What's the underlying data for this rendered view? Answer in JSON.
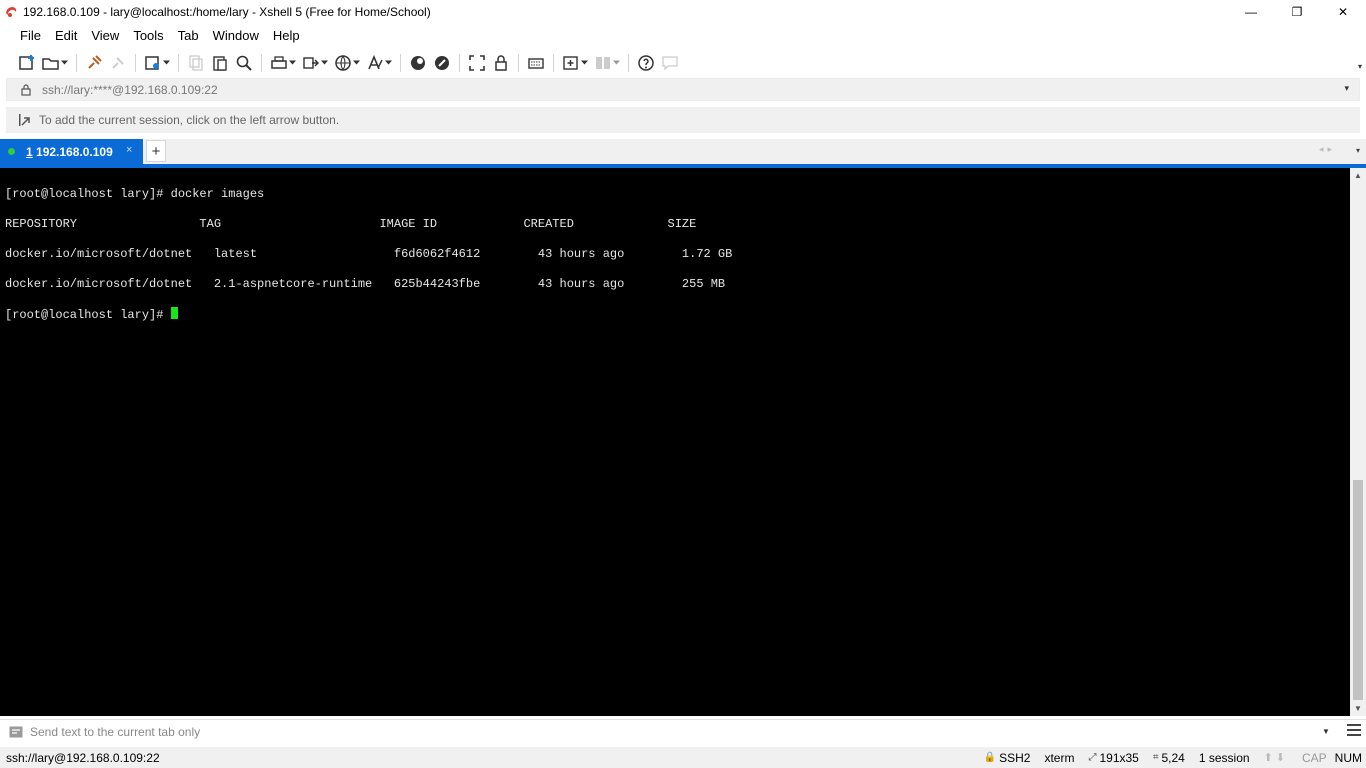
{
  "window": {
    "title": "192.168.0.109 - lary@localhost:/home/lary - Xshell 5 (Free for Home/School)",
    "minimize": "—",
    "maximize": "❐",
    "close": "✕"
  },
  "menu": [
    "File",
    "Edit",
    "View",
    "Tools",
    "Tab",
    "Window",
    "Help"
  ],
  "address": {
    "text": "ssh://lary:****@192.168.0.109:22",
    "dropdown": "▾"
  },
  "infobar": {
    "text": "To add the current session, click on the left arrow button."
  },
  "tabs": {
    "active_number": "1",
    "active_label": " 192.168.0.109",
    "close": "×",
    "add": "+",
    "nav": "◂▸",
    "menu": "▾"
  },
  "terminal": {
    "lines": [
      "[root@localhost lary]# docker images",
      "REPOSITORY                 TAG                      IMAGE ID            CREATED             SIZE",
      "docker.io/microsoft/dotnet   latest                   f6d6062f4612        43 hours ago        1.72 GB",
      "docker.io/microsoft/dotnet   2.1-aspnetcore-runtime   625b44243fbe        43 hours ago        255 MB"
    ],
    "prompt": "[root@localhost lary]# ",
    "cursor_color": "#19e619",
    "background": "#000000"
  },
  "sendbar": {
    "placeholder": "Send text to the current tab only"
  },
  "status": {
    "connection": "ssh://lary@192.168.0.109:22",
    "protocol": "SSH2",
    "terminal": "xterm",
    "size": "191x35",
    "cursor_pos": "5,24",
    "sessions": "1 session",
    "arrows": "⬆⬇",
    "cap": "CAP",
    "num": "NUM"
  },
  "colors": {
    "accent": "#0a6ad6",
    "status_dot": "#2ecc40"
  }
}
